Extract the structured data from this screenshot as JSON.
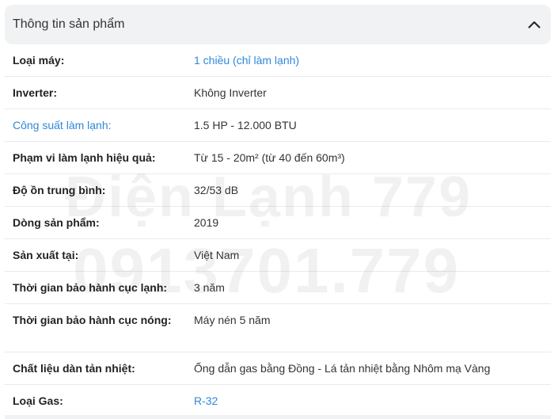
{
  "section": {
    "title": "Thông tin sản phẩm",
    "toggle_icon": "chevron-up-icon"
  },
  "specs": [
    {
      "label": "Loại máy:",
      "value": "1 chiều (chỉ làm lạnh)",
      "label_is_link": false,
      "value_is_link": true
    },
    {
      "label": "Inverter:",
      "value": "Không Inverter",
      "label_is_link": false,
      "value_is_link": false
    },
    {
      "label": "Công suất làm lạnh:",
      "value": "1.5 HP - 12.000 BTU",
      "label_is_link": true,
      "value_is_link": false
    },
    {
      "label": "Phạm vi làm lạnh hiệu quả:",
      "value": "Từ 15 - 20m² (từ 40 đến 60m³)",
      "label_is_link": false,
      "value_is_link": false
    },
    {
      "label": "Độ ồn trung bình:",
      "value": "32/53 dB",
      "label_is_link": false,
      "value_is_link": false
    },
    {
      "label": "Dòng sản phẩm:",
      "value": "2019",
      "label_is_link": false,
      "value_is_link": false
    },
    {
      "label": "Sản xuất tại:",
      "value": "Việt Nam",
      "label_is_link": false,
      "value_is_link": false
    },
    {
      "label": "Thời gian bảo hành cục lạnh:",
      "value": "3 năm",
      "label_is_link": false,
      "value_is_link": false
    },
    {
      "label": "Thời gian bảo hành cục nóng:",
      "value": "Máy nén 5 năm",
      "label_is_link": false,
      "value_is_link": false
    },
    {
      "label": "Chất liệu dàn tản nhiệt:",
      "value": "Ống dẫn gas bằng Đồng - Lá tản nhiệt bằng Nhôm mạ Vàng",
      "label_is_link": false,
      "value_is_link": false
    },
    {
      "label": "Loại Gas:",
      "value": "R-32",
      "label_is_link": false,
      "value_is_link": true
    }
  ],
  "watermark": {
    "line1": "Điện Lạnh 779",
    "line2": "0913701.779"
  },
  "colors": {
    "link": "#2f88d9",
    "header_bg": "#f1f2f4",
    "divider": "#e9eaec"
  }
}
